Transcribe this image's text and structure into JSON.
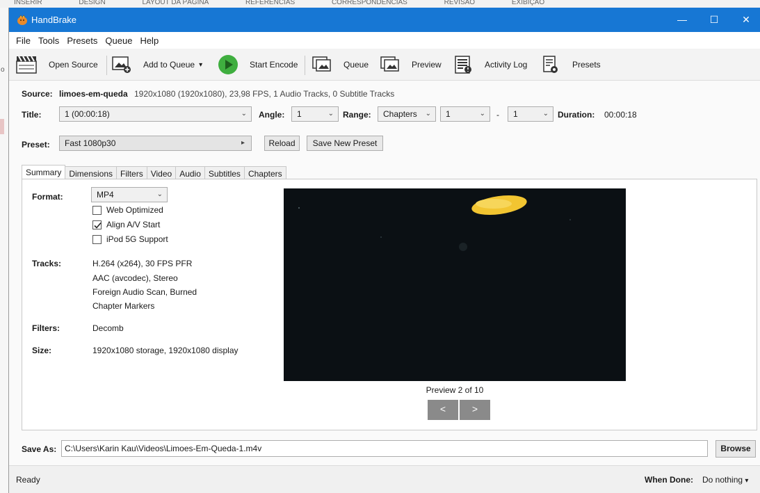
{
  "background": {
    "ribbon_tabs": [
      "INSERIR",
      "DESIGN",
      "LAYOUT DA PÁGINA",
      "REFERÊNCIAS",
      "CORRESPONDÊNCIAS",
      "REVISÃO",
      "EXIBIÇÃO"
    ],
    "left_mark": "o"
  },
  "window": {
    "title": "HandBrake",
    "minimize": "—",
    "maximize": "☐",
    "close": "✕"
  },
  "menu": [
    "File",
    "Tools",
    "Presets",
    "Queue",
    "Help"
  ],
  "toolbar": {
    "open_source": "Open Source",
    "add_to_queue": "Add to Queue",
    "add_to_queue_arrow": "▾",
    "start_encode": "Start Encode",
    "queue": "Queue",
    "preview": "Preview",
    "activity_log": "Activity Log",
    "presets": "Presets"
  },
  "source": {
    "label": "Source:",
    "name": "limoes-em-queda",
    "details": "1920x1080 (1920x1080), 23,98 FPS, 1 Audio Tracks, 0 Subtitle Tracks"
  },
  "title_row": {
    "title_label": "Title:",
    "title_value": "1 (00:00:18)",
    "angle_label": "Angle:",
    "angle_value": "1",
    "range_label": "Range:",
    "range_type": "Chapters",
    "range_start": "1",
    "range_sep": "-",
    "range_end": "1",
    "duration_label": "Duration:",
    "duration_value": "00:00:18"
  },
  "preset_row": {
    "label": "Preset:",
    "value": "Fast 1080p30",
    "arrow": "▸",
    "reload": "Reload",
    "save_new": "Save New Preset"
  },
  "tabs": [
    "Summary",
    "Dimensions",
    "Filters",
    "Video",
    "Audio",
    "Subtitles",
    "Chapters"
  ],
  "active_tab": "Summary",
  "summary": {
    "format_label": "Format:",
    "format_value": "MP4",
    "checkboxes": [
      {
        "label": "Web Optimized",
        "checked": false
      },
      {
        "label": "Align A/V Start",
        "checked": true
      },
      {
        "label": "iPod 5G Support",
        "checked": false
      }
    ],
    "tracks_label": "Tracks:",
    "tracks": [
      "H.264 (x264), 30 FPS PFR",
      "AAC (avcodec), Stereo",
      "Foreign Audio Scan, Burned",
      "Chapter Markers"
    ],
    "filters_label": "Filters:",
    "filters_value": "Decomb",
    "size_label": "Size:",
    "size_value": "1920x1080 storage, 1920x1080 display"
  },
  "preview": {
    "caption": "Preview 2 of 10",
    "prev": "<",
    "next": ">"
  },
  "save_as": {
    "label": "Save As:",
    "path": "C:\\Users\\Karin Kau\\Videos\\Limoes-Em-Queda-1.m4v",
    "browse": "Browse"
  },
  "status": {
    "text": "Ready",
    "when_done_label": "When Done:",
    "when_done_value": "Do nothing",
    "when_done_arrow": "▾"
  },
  "colors": {
    "titlebar": "#1777d4",
    "start_encode_green": "#3fae3f",
    "preview_bg": "#0b1014",
    "lemon": "#f2c531"
  }
}
